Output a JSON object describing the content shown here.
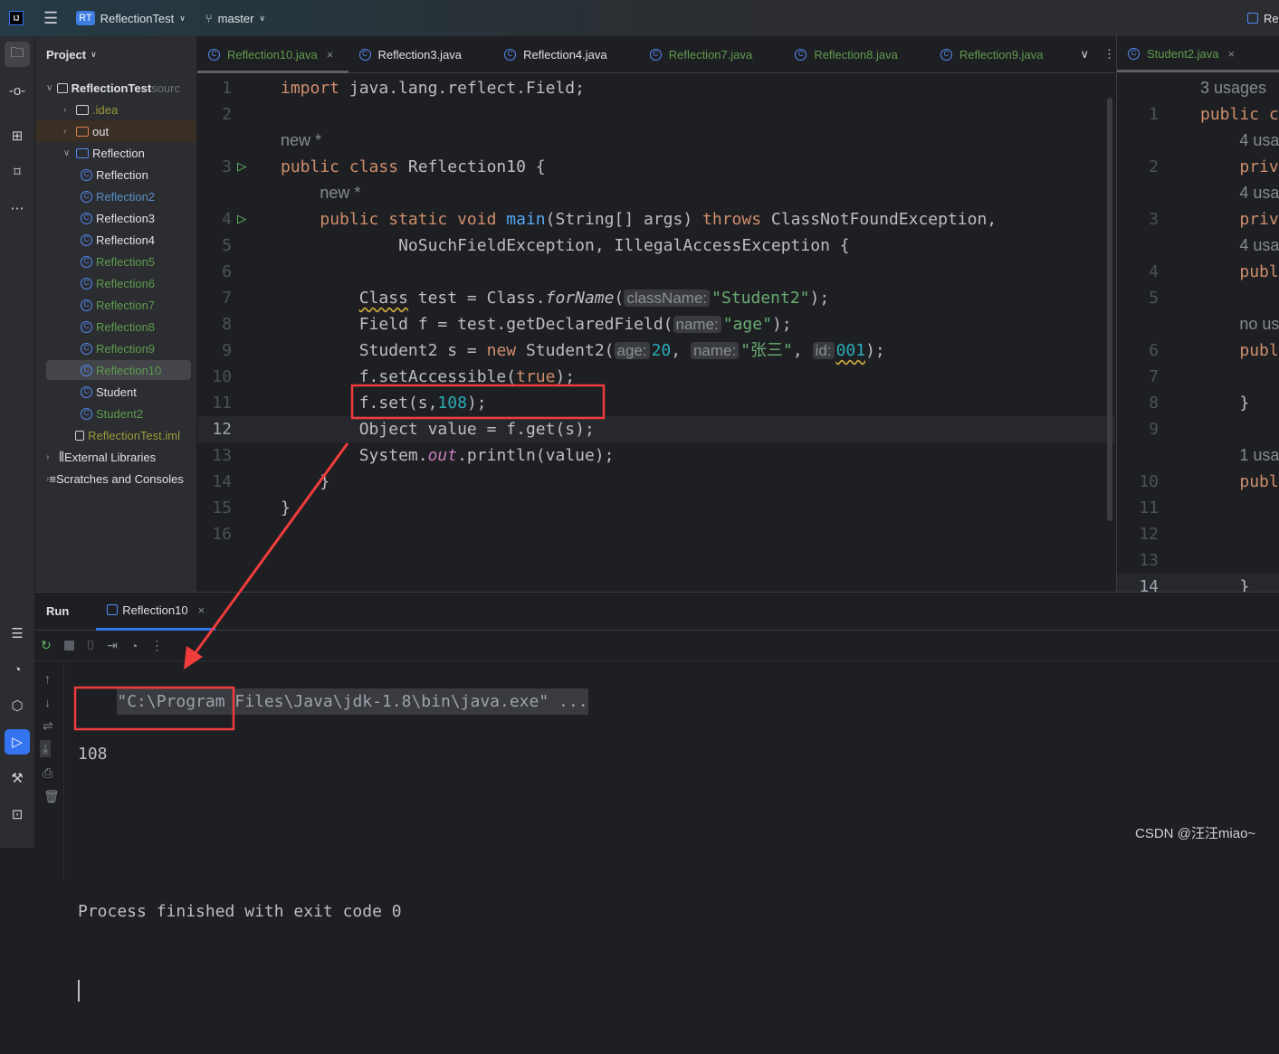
{
  "titlebar": {
    "logo": "IJ",
    "project_badge": "RT",
    "project": "ReflectionTest",
    "branch": "master",
    "right_label": "Re"
  },
  "project_panel": {
    "title": "Project",
    "items": [
      {
        "label": "ReflectionTest",
        "suffix": "sourc",
        "kind": "root",
        "color": "#dfe1e5"
      },
      {
        "label": ".idea",
        "kind": "folder",
        "color": "#9a9a3a"
      },
      {
        "label": "out",
        "kind": "folder-out",
        "color": "#dfe1e5"
      },
      {
        "label": "Reflection",
        "kind": "folder-open",
        "color": "#dfe1e5"
      },
      {
        "label": "Reflection",
        "kind": "class",
        "color": "#dfe1e5"
      },
      {
        "label": "Reflection2",
        "kind": "class",
        "color": "#5a8fc9"
      },
      {
        "label": "Reflection3",
        "kind": "class",
        "color": "#dfe1e5"
      },
      {
        "label": "Reflection4",
        "kind": "class",
        "color": "#dfe1e5"
      },
      {
        "label": "Reflection5",
        "kind": "class",
        "color": "#5f9b4f"
      },
      {
        "label": "Reflection6",
        "kind": "class",
        "color": "#5f9b4f"
      },
      {
        "label": "Reflection7",
        "kind": "class",
        "color": "#5f9b4f"
      },
      {
        "label": "Reflection8",
        "kind": "class",
        "color": "#5f9b4f"
      },
      {
        "label": "Reflection9",
        "kind": "class",
        "color": "#5f9b4f"
      },
      {
        "label": "Reflection10",
        "kind": "class",
        "color": "#5f9b4f",
        "selected": true
      },
      {
        "label": "Student",
        "kind": "class",
        "color": "#dfe1e5"
      },
      {
        "label": "Student2",
        "kind": "class",
        "color": "#5f9b4f"
      },
      {
        "label": "ReflectionTest.iml",
        "kind": "file",
        "color": "#9a9a3a"
      },
      {
        "label": "External Libraries",
        "kind": "lib",
        "color": "#dfe1e5"
      },
      {
        "label": "Scratches and Consoles",
        "kind": "scratch",
        "color": "#dfe1e5"
      }
    ]
  },
  "tabs": [
    {
      "label": "Reflection10.java",
      "active": true,
      "closable": true,
      "color": "#5f9b4f"
    },
    {
      "label": "Reflection3.java",
      "color": "#dfe1e5"
    },
    {
      "label": "Reflection4.java",
      "color": "#dfe1e5"
    },
    {
      "label": "Reflection7.java",
      "color": "#5f9b4f"
    },
    {
      "label": "Reflection8.java",
      "color": "#5f9b4f"
    },
    {
      "label": "Reflection9.java",
      "color": "#5f9b4f"
    }
  ],
  "right_tab": {
    "label": "Student2.java",
    "color": "#5f9b4f"
  },
  "warnings": {
    "count": "2"
  },
  "code": [
    {
      "num": "1",
      "ind": 0,
      "tk": [
        [
          "k",
          "import"
        ],
        [
          "t",
          " java.lang.reflect.Field;"
        ]
      ]
    },
    {
      "num": "2",
      "ind": 0,
      "tk": []
    },
    {
      "num": "",
      "ind": 0,
      "tk": [
        [
          "hint",
          "new *"
        ]
      ]
    },
    {
      "num": "3",
      "ind": 0,
      "run": true,
      "tk": [
        [
          "k",
          "public class"
        ],
        [
          "t",
          " Reflection10 {"
        ]
      ]
    },
    {
      "num": "",
      "ind": 4,
      "tk": [
        [
          "hint",
          "new *"
        ]
      ]
    },
    {
      "num": "4",
      "ind": 4,
      "run": true,
      "tk": [
        [
          "k",
          "public static void"
        ],
        [
          "t",
          " "
        ],
        [
          "b",
          "main"
        ],
        [
          "t",
          "(String[] args) "
        ],
        [
          "k",
          "throws"
        ],
        [
          "t",
          " ClassNotFoundException,"
        ]
      ]
    },
    {
      "num": "5",
      "ind": 12,
      "tk": [
        [
          "t",
          "NoSuchFieldException, IllegalAccessException {"
        ]
      ]
    },
    {
      "num": "6",
      "ind": 0,
      "tk": []
    },
    {
      "num": "7",
      "ind": 8,
      "tk": [
        [
          "u",
          "Class"
        ],
        [
          "t",
          " test = Class."
        ],
        [
          "i",
          "forName"
        ],
        [
          "t",
          "("
        ],
        [
          "h",
          "className:"
        ],
        [
          "s",
          "\"Student2\""
        ],
        [
          "t",
          ");"
        ]
      ]
    },
    {
      "num": "8",
      "ind": 8,
      "tk": [
        [
          "t",
          "Field f = test.getDeclaredField("
        ],
        [
          "h",
          "name:"
        ],
        [
          "s",
          "\"age\""
        ],
        [
          "t",
          ");"
        ]
      ]
    },
    {
      "num": "9",
      "ind": 8,
      "tk": [
        [
          "t",
          "Student2 s = "
        ],
        [
          "k",
          "new"
        ],
        [
          "t",
          " Student2("
        ],
        [
          "h",
          "age:"
        ],
        [
          "n",
          "20"
        ],
        [
          "t",
          ", "
        ],
        [
          "h",
          "name:"
        ],
        [
          "s",
          "\"张三\""
        ],
        [
          "t",
          ", "
        ],
        [
          "h",
          "id:"
        ],
        [
          "nu",
          "001"
        ],
        [
          "t",
          ");"
        ]
      ]
    },
    {
      "num": "10",
      "ind": 8,
      "tk": [
        [
          "t",
          "f.setAccessible("
        ],
        [
          "k",
          "true"
        ],
        [
          "t",
          ");"
        ]
      ]
    },
    {
      "num": "11",
      "ind": 8,
      "tk": [
        [
          "t",
          "f.set(s,"
        ],
        [
          "n",
          "108"
        ],
        [
          "t",
          ");"
        ]
      ]
    },
    {
      "num": "12",
      "ind": 8,
      "cur": true,
      "tk": [
        [
          "t",
          "Object value = f.get(s);"
        ]
      ]
    },
    {
      "num": "13",
      "ind": 8,
      "tk": [
        [
          "t",
          "System."
        ],
        [
          "p",
          "out"
        ],
        [
          "t",
          ".println(value);"
        ]
      ]
    },
    {
      "num": "14",
      "ind": 4,
      "tk": [
        [
          "t",
          "}"
        ]
      ]
    },
    {
      "num": "15",
      "ind": 0,
      "tk": [
        [
          "t",
          "}"
        ]
      ]
    },
    {
      "num": "16",
      "ind": 0,
      "tk": []
    }
  ],
  "right_code": [
    {
      "num": "",
      "ind": 0,
      "tk": [
        [
          "hint",
          "3 usages"
        ]
      ]
    },
    {
      "num": "1",
      "ind": 0,
      "tk": [
        [
          "k",
          "public c"
        ]
      ]
    },
    {
      "num": "",
      "ind": 4,
      "tk": [
        [
          "hint",
          "4 usa"
        ]
      ]
    },
    {
      "num": "2",
      "ind": 4,
      "tk": [
        [
          "k",
          "priv"
        ]
      ]
    },
    {
      "num": "",
      "ind": 4,
      "tk": [
        [
          "hint",
          "4 usa"
        ]
      ]
    },
    {
      "num": "3",
      "ind": 4,
      "tk": [
        [
          "k",
          "priv"
        ]
      ]
    },
    {
      "num": "",
      "ind": 4,
      "tk": [
        [
          "hint",
          "4 usa"
        ]
      ]
    },
    {
      "num": "4",
      "ind": 4,
      "tk": [
        [
          "k",
          "publ"
        ]
      ]
    },
    {
      "num": "5",
      "ind": 0,
      "tk": []
    },
    {
      "num": "",
      "ind": 4,
      "tk": [
        [
          "hint",
          "no us"
        ]
      ]
    },
    {
      "num": "6",
      "ind": 4,
      "tk": [
        [
          "k",
          "publ"
        ]
      ]
    },
    {
      "num": "7",
      "ind": 0,
      "tk": []
    },
    {
      "num": "8",
      "ind": 4,
      "tk": [
        [
          "t",
          "}"
        ]
      ]
    },
    {
      "num": "9",
      "ind": 0,
      "tk": []
    },
    {
      "num": "",
      "ind": 4,
      "tk": [
        [
          "hint",
          "1 usa"
        ]
      ]
    },
    {
      "num": "10",
      "ind": 4,
      "tk": [
        [
          "k",
          "publ"
        ]
      ]
    },
    {
      "num": "11",
      "ind": 0,
      "tk": []
    },
    {
      "num": "12",
      "ind": 0,
      "tk": []
    },
    {
      "num": "13",
      "ind": 0,
      "tk": []
    },
    {
      "num": "14",
      "ind": 4,
      "cur": true,
      "tk": [
        [
          "t",
          "}"
        ]
      ]
    }
  ],
  "run": {
    "title": "Run",
    "tab": "Reflection10",
    "console": {
      "command": "\"C:\\Program Files\\Java\\jdk-1.8\\bin\\java.exe\" ...",
      "output": "108",
      "finish": "Process finished with exit code 0"
    }
  },
  "watermark": "CSDN @汪汪miao~",
  "colors": {
    "annotation": "#f03c3c",
    "accent": "#3574f0"
  }
}
